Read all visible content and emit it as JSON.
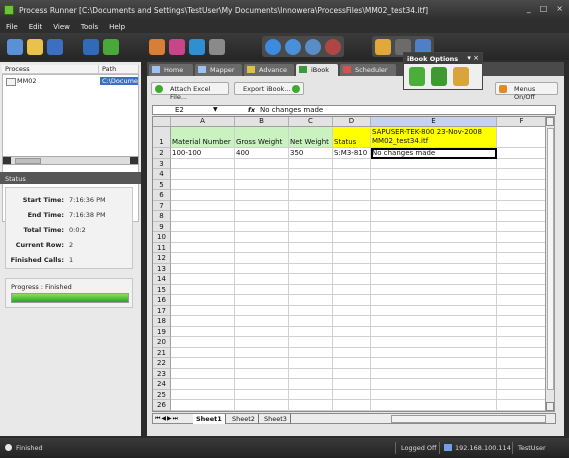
{
  "window": {
    "title": "Process Runner [C:\\Documents and Settings\\TestUser\\My Documents\\Innowera\\ProcessFiles\\MM02_test34.itf]",
    "controls": [
      "_",
      "□",
      "×"
    ]
  },
  "menu": [
    "File",
    "Edit",
    "View",
    "Tools",
    "Help"
  ],
  "process_list": {
    "headers": [
      "Process",
      "Path"
    ],
    "rows": [
      {
        "process": "MM02",
        "path": "C:\\Documen"
      }
    ]
  },
  "status_panel": {
    "header": "Status",
    "fields": [
      {
        "label": "Start Time:",
        "value": "7:16:36 PM"
      },
      {
        "label": "End Time:",
        "value": "7:16:38 PM"
      },
      {
        "label": "Total Time:",
        "value": "0:0:2"
      },
      {
        "label": "Current Row:",
        "value": "2"
      },
      {
        "label": "Finished Calls:",
        "value": "1"
      }
    ],
    "progress_label": "Progress : Finished",
    "progress_fraction": 1.0
  },
  "tabs": [
    {
      "label": "Home",
      "active": false
    },
    {
      "label": "Mapper",
      "active": false
    },
    {
      "label": "Advance",
      "active": false
    },
    {
      "label": "iBook",
      "active": true
    },
    {
      "label": "Scheduler",
      "active": false
    }
  ],
  "buttons": {
    "attach": "Attach Excel File...",
    "export": "Export iBook...",
    "menus": "Menus On/Off"
  },
  "popup": {
    "title": "iBook Options"
  },
  "formula_bar": {
    "cell_ref": "E2",
    "fx": "fx",
    "value": "No changes made"
  },
  "sheet": {
    "columns": [
      "A",
      "B",
      "C",
      "D",
      "E",
      "F"
    ],
    "row_count": 26,
    "row1": {
      "A": "Material Number",
      "B": "Gross Weight",
      "C": "Net Weight",
      "D": "Status",
      "E": "SAPUSER-TEK-800 23-Nov-2008 MM02_test34.itf"
    },
    "row2": {
      "A": "100-100",
      "B": "400",
      "C": "350",
      "D": "S:M3-810",
      "E": "No changes made"
    },
    "tabs": [
      "Sheet1",
      "Sheet2",
      "Sheet3"
    ],
    "active_tab": "Sheet1"
  },
  "statusbar": {
    "left": "Finished",
    "logged": "Logged Off",
    "ip": "192.168.100.114",
    "user": "TestUser"
  }
}
